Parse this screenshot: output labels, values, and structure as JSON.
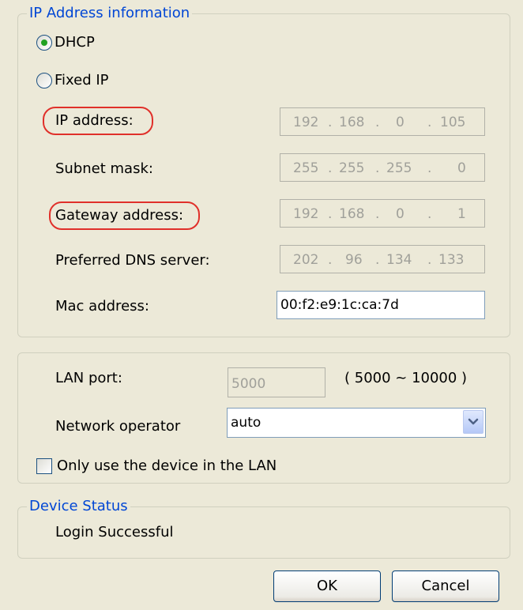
{
  "ip_group": {
    "title": "IP Address information",
    "dhcp_label": "DHCP",
    "fixed_ip_label": "Fixed IP",
    "dhcp_selected": true,
    "fields": {
      "ip_address": {
        "label": "IP address:",
        "octets": [
          "192",
          "168",
          "0",
          "105"
        ]
      },
      "subnet_mask": {
        "label": "Subnet mask:",
        "octets": [
          "255",
          "255",
          "255",
          "0"
        ]
      },
      "gateway": {
        "label": "Gateway address:",
        "octets": [
          "192",
          "168",
          "0",
          "1"
        ]
      },
      "dns": {
        "label": "Preferred DNS server:",
        "octets": [
          "202",
          "96",
          "134",
          "133"
        ]
      }
    },
    "mac": {
      "label": "Mac address:",
      "value": "00:f2:e9:1c:ca:7d"
    }
  },
  "lan_group": {
    "lan_port_label": "LAN port:",
    "lan_port_value": "5000",
    "lan_port_range": "( 5000 ~ 10000 )",
    "operator_label": "Network operator",
    "operator_value": "auto",
    "lan_only_label": "Only use the device in the LAN",
    "lan_only_checked": false
  },
  "status_group": {
    "title": "Device Status",
    "status_text": "Login Successful"
  },
  "buttons": {
    "ok": "OK",
    "cancel": "Cancel"
  },
  "colors": {
    "background": "#ece9d8",
    "legend": "#0046d5",
    "highlight": "#e0302a",
    "radio_selected": "#21a121"
  }
}
